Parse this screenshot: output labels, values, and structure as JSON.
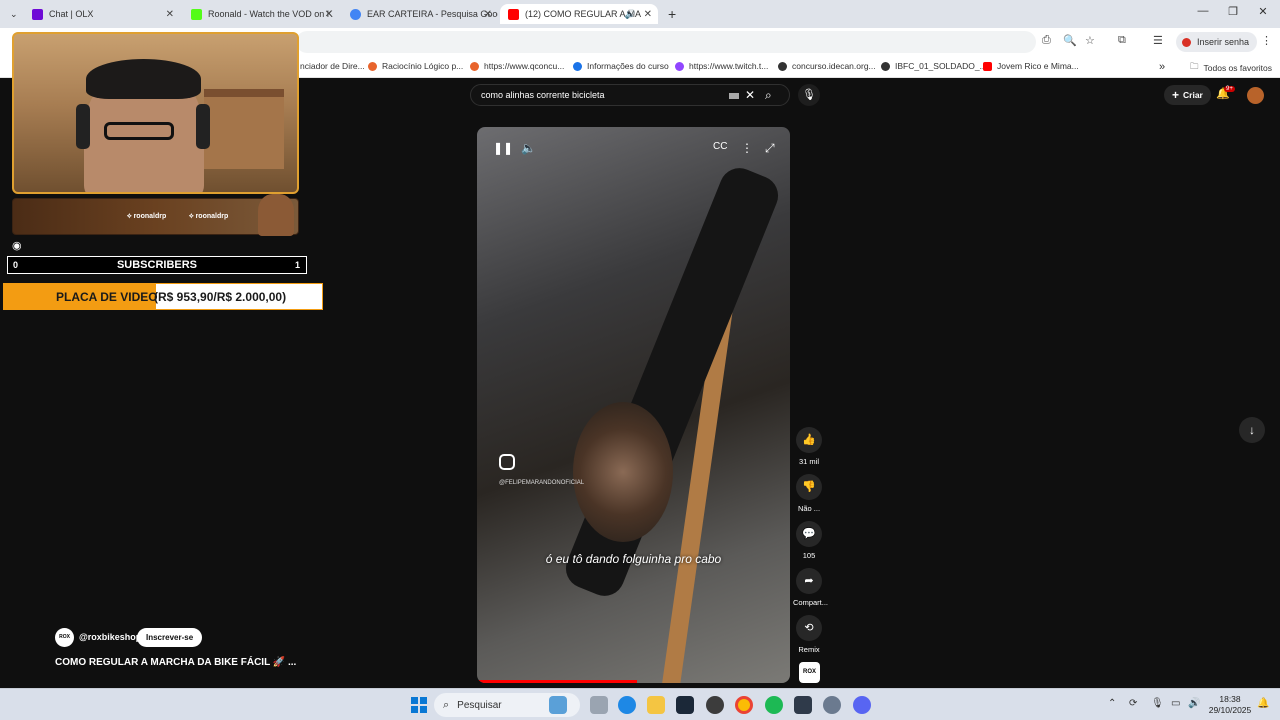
{
  "browser": {
    "tabs": [
      {
        "title": "Chat | OLX",
        "color": "#6e0ad6",
        "active": false
      },
      {
        "title": "Roonald - Watch the VOD on K",
        "color": "#53fc18",
        "active": false
      },
      {
        "title": "EAR CARTEIRA - Pesquisa Goog",
        "color": "#4285f4",
        "active": false
      },
      {
        "title": "(12) COMO REGULAR A MA",
        "color": "#ff0000",
        "active": true
      }
    ],
    "new_tab": "+",
    "signin_label": "Inserir senha",
    "bookmarks": [
      {
        "label": "nciador de Dire...",
        "color": "#888888"
      },
      {
        "label": "Raciocínio Lógico p...",
        "color": "#e8642c"
      },
      {
        "label": "https://www.qconcu...",
        "color": "#e8642c"
      },
      {
        "label": "Informações do curso",
        "color": "#1a73e8"
      },
      {
        "label": "https://www.twitch.t...",
        "color": "#9146ff"
      },
      {
        "label": "concurso.idecan.org...",
        "color": "#333333"
      },
      {
        "label": "IBFC_01_SOLDADO_...",
        "color": "#333333"
      },
      {
        "label": "Jovem Rico e Mima...",
        "color": "#ff0000"
      }
    ],
    "all_bookmarks": "Todos os favoritos"
  },
  "youtube": {
    "search_query": "como alinhas corrente bicicleta",
    "create_label": "Criar",
    "notifications": "9+",
    "video": {
      "instagram_handle": "@FELIPEMARANDONOFICIAL",
      "caption": "ó eu tô dando folguinha pro cabo",
      "progress": 0.51
    },
    "actions": {
      "likes": "31 mil",
      "dislike": "Não ...",
      "comments": "105",
      "share": "Compart...",
      "remix": "Remix"
    },
    "channel": {
      "handle": "@roxbikeshop",
      "avatar_text": "ROX",
      "subscribe_label": "Inscrever-se"
    },
    "title": "COMO REGULAR A MARCHA DA BIKE FÁCIL 🚀 ..."
  },
  "overlay": {
    "social_handles": [
      "roonaldrp",
      "roonaldrp"
    ],
    "subs": {
      "left": "0",
      "title": "SUBSCRIBERS",
      "right": "1"
    },
    "goal": {
      "title": "PLACA DE VIDEO",
      "value": "(R$ 953,90/R$ 2.000,00)",
      "progress": 0.477
    }
  },
  "taskbar": {
    "search_placeholder": "Pesquisar",
    "time": "18:38",
    "date": "29/10/2025"
  }
}
